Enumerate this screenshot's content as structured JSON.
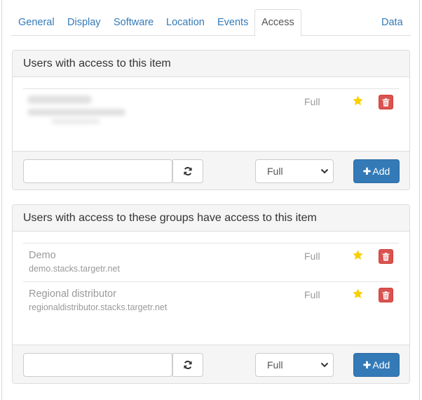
{
  "tabs": [
    {
      "label": "General",
      "active": false
    },
    {
      "label": "Display",
      "active": false
    },
    {
      "label": "Software",
      "active": false
    },
    {
      "label": "Location",
      "active": false
    },
    {
      "label": "Events",
      "active": false
    },
    {
      "label": "Access",
      "active": true
    },
    {
      "label": "Data",
      "active": false
    }
  ],
  "users_panel": {
    "title": "Users with access to this item",
    "rows": [
      {
        "name": "",
        "sub": "",
        "level": "Full",
        "obscured": true
      }
    ],
    "footer": {
      "input_value": "",
      "select_value": "Full",
      "add_label": "Add"
    }
  },
  "groups_panel": {
    "title": "Users with access to these groups have access to this item",
    "rows": [
      {
        "name": "Demo",
        "sub": "demo.stacks.targetr.net",
        "level": "Full"
      },
      {
        "name": "Regional distributor",
        "sub": "regionaldistributor.stacks.targetr.net",
        "level": "Full"
      }
    ],
    "footer": {
      "input_value": "",
      "select_value": "Full",
      "add_label": "Add"
    }
  },
  "colors": {
    "link": "#337ab7",
    "primary": "#337ab7",
    "danger": "#d9534f",
    "star": "#f7d000",
    "muted": "#999999"
  },
  "icons": {
    "refresh": "refresh-icon",
    "star": "star-icon",
    "delete": "trash-icon",
    "plus": "plus-icon"
  }
}
